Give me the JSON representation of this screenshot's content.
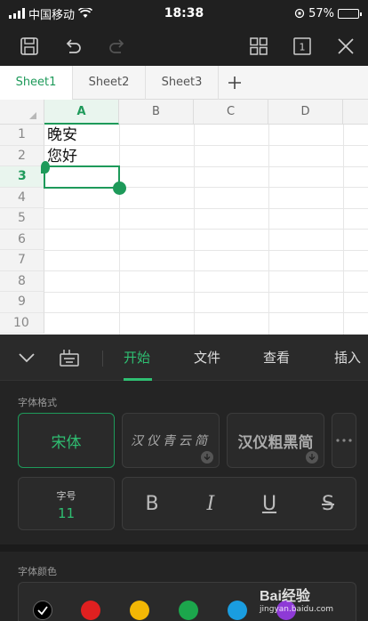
{
  "status": {
    "carrier": "中国移动",
    "time": "18:38",
    "battery": "57%",
    "battery_level": 0.57
  },
  "sheets": {
    "tabs": [
      "Sheet1",
      "Sheet2",
      "Sheet3"
    ],
    "active": 0
  },
  "grid": {
    "columns": [
      "A",
      "B",
      "C",
      "D"
    ],
    "rows": [
      "1",
      "2",
      "3",
      "4",
      "5",
      "6",
      "7",
      "8",
      "9",
      "10"
    ],
    "cells": {
      "A1": "晚安",
      "A2": "您好"
    }
  },
  "panel": {
    "tabs": [
      "开始",
      "文件",
      "查看",
      "插入"
    ],
    "font_format_label": "字体格式",
    "fonts": [
      "宋体",
      "汉仪青云简",
      "汉仪粗黑简"
    ],
    "size_label": "字号",
    "size_value": "11",
    "styles": [
      "B",
      "I",
      "U",
      "S"
    ],
    "font_color_label": "字体颜色",
    "colors": [
      "#000000",
      "#e02020",
      "#f2b705",
      "#1ca64c",
      "#1a9de0",
      "#8e3ad6"
    ]
  },
  "watermark": {
    "brand": "Bai经验",
    "url": "jingyan.baidu.com"
  }
}
